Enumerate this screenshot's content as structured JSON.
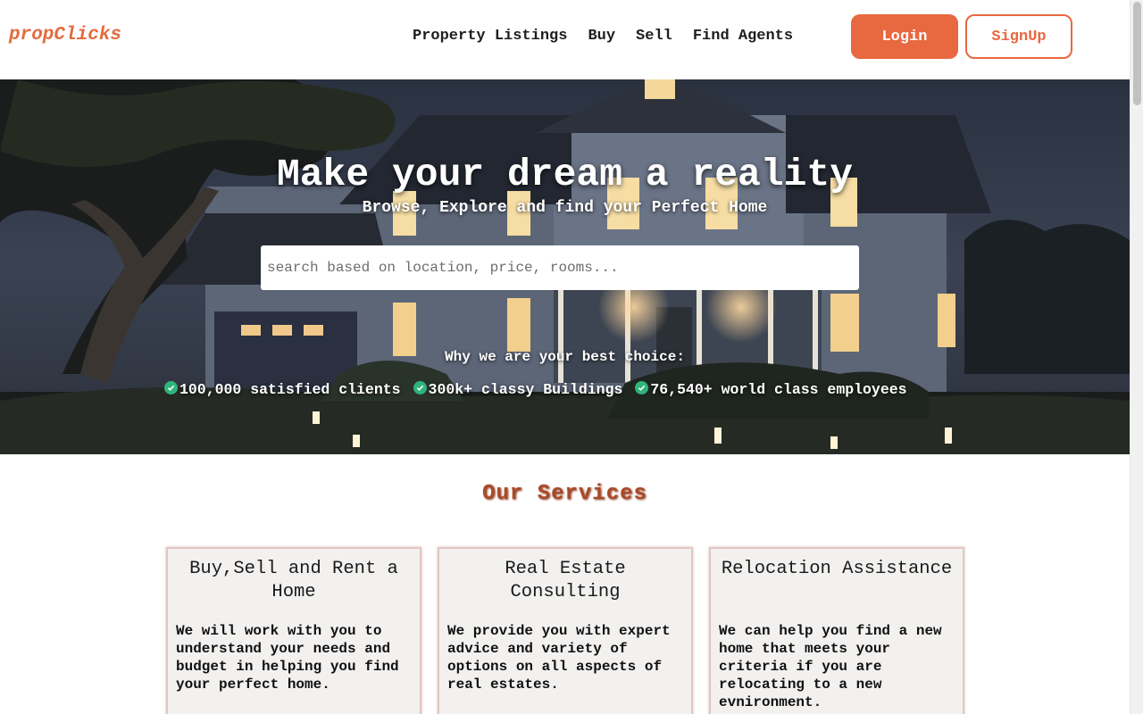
{
  "app": {
    "brand": "propClicks",
    "accent": "#e8683f"
  },
  "nav": {
    "links": [
      "Property Listings",
      "Buy",
      "Sell",
      "Find Agents"
    ],
    "login_label": "Login",
    "signup_label": "SignUp"
  },
  "hero": {
    "title": "Make your dream a reality",
    "subtitle": "Browse, Explore and find your Perfect Home",
    "search_placeholder": "search based on location, price, rooms...",
    "why_text": "Why we are your best choice:",
    "stats": [
      "100,000 satisfied clients",
      "300k+ classy Buildings",
      "76,540+ world class employees"
    ],
    "stat_icon": "check-circle-icon",
    "stat_icon_color": "#2fb47c"
  },
  "services": {
    "title": "Our Services",
    "cards": [
      {
        "title": "Buy,Sell and Rent a Home",
        "body": "We will work with you to understand your needs and budget in helping you find your perfect home."
      },
      {
        "title": "Real Estate Consulting",
        "body": "We provide you with expert advice and variety of options on all aspects of real estates."
      },
      {
        "title": "Relocation Assistance",
        "body": "We can help you find a new home that meets your criteria if you are relocating to a new evnironment."
      }
    ]
  }
}
